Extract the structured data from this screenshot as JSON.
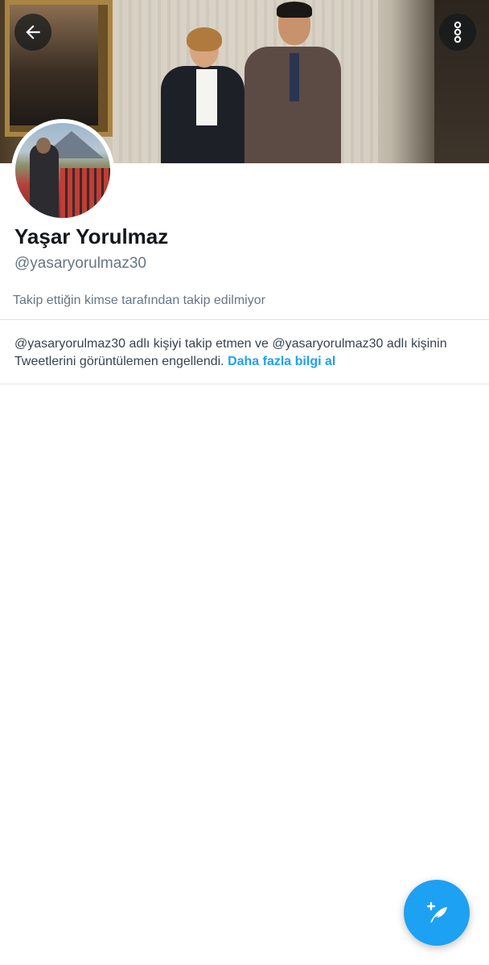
{
  "profile": {
    "name": "Yaşar Yorulmaz",
    "handle": "@yasaryorulmaz30",
    "follow_info": "Takip ettiğin kimse tarafından takip edilmiyor"
  },
  "blocked_notice": {
    "text": "@yasaryorulmaz30 adlı kişiyi takip etmen ve @yasaryorulmaz30 adlı kişinin Tweetlerini görüntülemen engellendi.",
    "link_label": "Daha fazla bilgi al"
  },
  "icons": {
    "back": "arrow-left-icon",
    "more": "more-vertical-icon",
    "compose": "compose-tweet-icon"
  },
  "colors": {
    "accent": "#1da1f2",
    "secondary_text": "#657786",
    "primary_text": "#14171a",
    "divider": "#dfe3e6"
  }
}
